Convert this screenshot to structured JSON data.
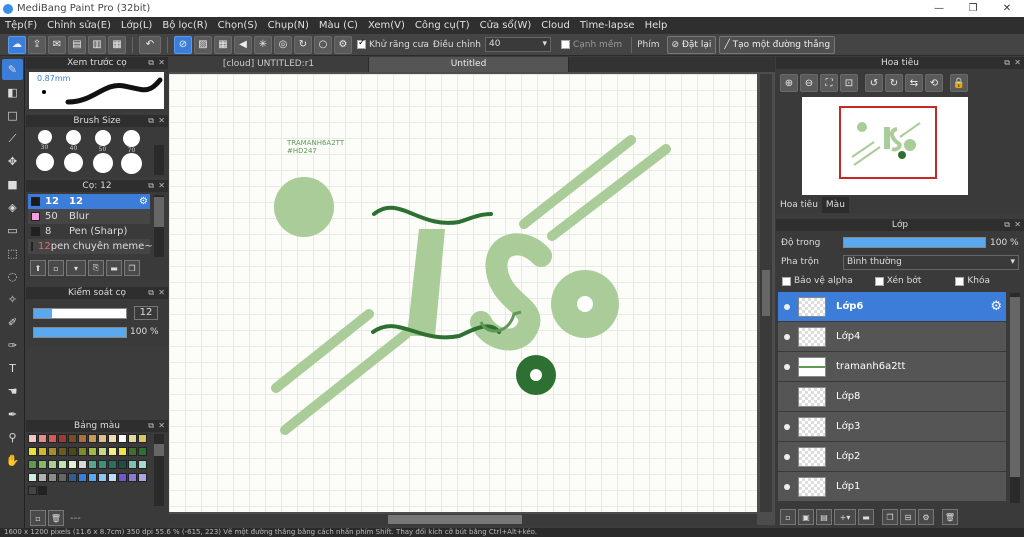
{
  "window": {
    "title": "MediBang Paint Pro (32bit)",
    "minimize": "—",
    "maximize": "❐",
    "close": "✕"
  },
  "menu": [
    "Tệp(F)",
    "Chỉnh sửa(E)",
    "Lớp(L)",
    "Bộ lọc(R)",
    "Chọn(S)",
    "Chụp(N)",
    "Màu (C)",
    "Xem(V)",
    "Công cụ(T)",
    "Cửa sổ(W)",
    "Cloud",
    "Time-lapse",
    "Help"
  ],
  "toolbar": {
    "antialias_label": "Khử răng cưa",
    "adjust_label": "Điều chỉnh",
    "adjust_value": "40",
    "edge_label": "Cạnh mềm",
    "keys_label": "Phím",
    "reset_label": "Đặt lại",
    "straight_label": "Tạo một đường thẳng"
  },
  "brush_preview": {
    "title": "Xem trước cọ",
    "size_text": "0.87mm"
  },
  "brush_size": {
    "title": "Brush Size",
    "sizes": [
      "30",
      "40",
      "50",
      "70",
      "",
      "",
      "",
      ""
    ]
  },
  "brush_list": {
    "title": "Cọ: 12",
    "items": [
      {
        "size": "12",
        "name": "12",
        "color": "#1c1c1c",
        "selected": true
      },
      {
        "size": "50",
        "name": "Blur",
        "color": "#f19fe3",
        "selected": false
      },
      {
        "size": "8",
        "name": "Pen (Sharp)",
        "color": "#202020",
        "selected": false
      },
      {
        "size": "12",
        "name": "pen chuyên meme~",
        "color": "#e52a2a",
        "selected": false
      }
    ]
  },
  "brush_control": {
    "title": "Kiểm soát cọ",
    "size_value": "12",
    "opacity_value": "100 %",
    "size_fill": 0.2,
    "opacity_fill": 1.0
  },
  "palette": {
    "title": "Bảng màu",
    "bottom_text": "---"
  },
  "tabs": {
    "tab1": "[cloud] UNTITLED:r1",
    "tab2": "Untitled"
  },
  "canvas": {
    "text_line1": "TRAMANH6A2TT",
    "text_line2": "#HD247"
  },
  "navigator": {
    "title": "Hoa tiêu",
    "tab_nav": "Hoa tiêu",
    "tab_color": "Màu"
  },
  "layers": {
    "title": "Lớp",
    "opacity_label": "Độ trong",
    "opacity_value": "100 %",
    "opacity_fill": 1.0,
    "blend_label": "Pha trộn",
    "blend_value": "Bình thường",
    "protect_alpha": "Bảo vệ alpha",
    "clipping": "Xén bớt",
    "lock": "Khóa",
    "items": [
      {
        "name": "Lớp6",
        "selected": true
      },
      {
        "name": "Lớp4",
        "selected": false
      },
      {
        "name": "tramanh6a2tt",
        "selected": false
      },
      {
        "name": "Lớp8",
        "selected": false
      },
      {
        "name": "Lớp3",
        "selected": false
      },
      {
        "name": "Lớp2",
        "selected": false
      },
      {
        "name": "Lớp1",
        "selected": false
      }
    ]
  },
  "status": {
    "text": "1600 x 1200 pixels (11.6 x 8.7cm)  350 dpi  55.6 %  (-615, 223)  Vẽ một đường thẳng bằng cách nhấn phím Shift. Thay đổi kích cỡ bút bằng Ctrl+Alt+kéo."
  },
  "colors": {
    "accent": "#3b7dd8",
    "ink_dark": "#2e7031",
    "ink_mid": "#5f9a55",
    "ink_light": "#a9cc99"
  }
}
